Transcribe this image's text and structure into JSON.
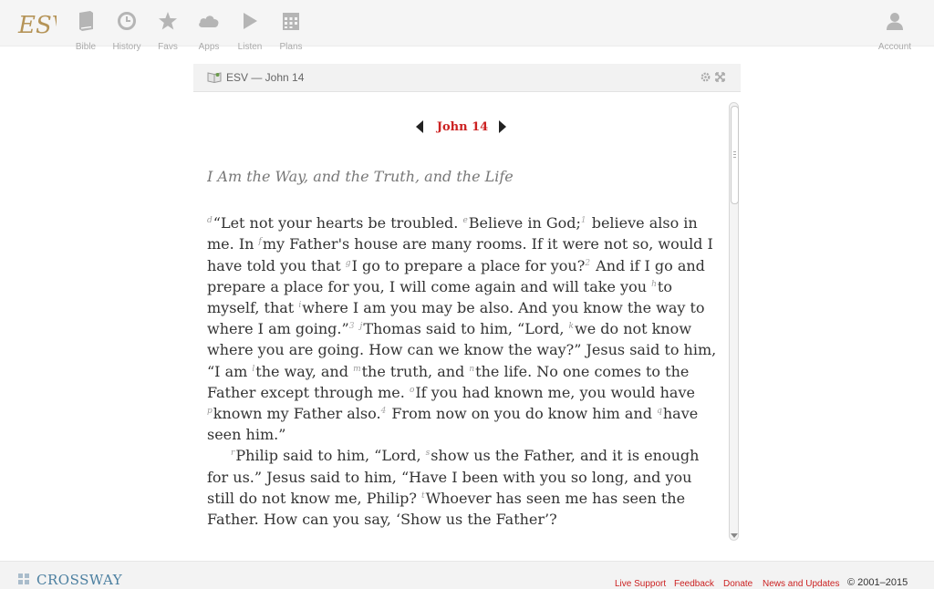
{
  "nav": {
    "logo_text": "ESV",
    "items": [
      {
        "label": "Bible",
        "icon": "book-icon"
      },
      {
        "label": "History",
        "icon": "clock-icon"
      },
      {
        "label": "Favs",
        "icon": "star-icon"
      },
      {
        "label": "Apps",
        "icon": "cloud-icon"
      },
      {
        "label": "Listen",
        "icon": "play-icon"
      },
      {
        "label": "Plans",
        "icon": "calendar-icon"
      }
    ],
    "account_label": "Account",
    "account_icon": "user-icon"
  },
  "panel": {
    "title": "ESV — John 14",
    "chapter": "John 14"
  },
  "passage": {
    "heading": "I Am the Way, and the Truth, and the Life",
    "p1": [
      {
        "m": "d",
        "t": "“Let not your hearts be troubled. "
      },
      {
        "m": "e",
        "t": "Believe in God;"
      },
      {
        "v": "1",
        "t": " believe also in me. In "
      },
      {
        "m": "f",
        "t": "my Father's house are many rooms. If it were not so, would I have told you that "
      },
      {
        "m": "g",
        "t": "I go to prepare a place for you?"
      },
      {
        "v": "2",
        "t": " And if I go and prepare a place for you, I will come again and will take you "
      },
      {
        "m": "h",
        "t": "to myself, that "
      },
      {
        "m": "i",
        "t": "where I am you may be also. And you know the way to where I am going.”"
      },
      {
        "v": "3",
        "t": " "
      },
      {
        "m": "j",
        "t": "Thomas said to him, “Lord, "
      },
      {
        "m": "k",
        "t": "we do not know where you are going. How can we know the way?” Jesus said to him, “I am "
      },
      {
        "m": "l",
        "t": "the way, and "
      },
      {
        "m": "m",
        "t": "the truth, and "
      },
      {
        "m": "n",
        "t": "the life. No one comes to the Father except through me. "
      },
      {
        "m": "o",
        "t": "If you had known me, you would have "
      },
      {
        "m": "p",
        "t": "known my Father also."
      },
      {
        "v": "4",
        "t": " From now on you do know him and "
      },
      {
        "m": "q",
        "t": "have seen him.”"
      }
    ],
    "p2": [
      {
        "m": "r",
        "t": "Philip said to him, “Lord, "
      },
      {
        "m": "s",
        "t": "show us the Father, and it is enough for us.” Jesus said to him, “Have I been with you so long, and you still do not know me, Philip? "
      },
      {
        "m": "t",
        "t": "Whoever has seen me has seen the Father. How can you say, ‘Show us the Father’?"
      }
    ]
  },
  "footer": {
    "brand": "CROSSWAY",
    "links": [
      "Live Support",
      "Feedback",
      "Donate",
      "News and Updates"
    ],
    "copyright": "© 2001–2015"
  },
  "colors": {
    "accent_red": "#cc2222",
    "icon_grey": "#b5b5b5",
    "logo_gold": "#b59458",
    "brand_blue": "#4b7fa0"
  }
}
